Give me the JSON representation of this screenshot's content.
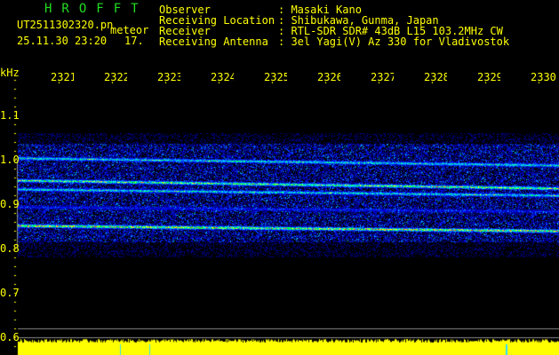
{
  "logo": "HROFFT",
  "file": "UT2511302320.pn",
  "mode": "meteor",
  "datetime": "25.11.30 23:20",
  "level": "17.",
  "info": [
    {
      "label": "Observer",
      "value": "Masaki Kano"
    },
    {
      "label": "Receiving Location",
      "value": "Shibukawa, Gunma, Japan"
    },
    {
      "label": "Receiver",
      "value": "RTL-SDR SDR# 43dB L15 103.2MHz CW"
    },
    {
      "label": "Receiving Antenna",
      "value": "3el Yagi(V) Az 330 for Vladivostok"
    }
  ],
  "yunit": "kHz",
  "time_ticks": [
    "2321",
    "2322",
    "2323",
    "2324",
    "2325",
    "2326",
    "2327",
    "2328",
    "2329",
    "2330"
  ],
  "freq_ticks": [
    "1.1",
    "1.0",
    "0.9",
    "0.8",
    "0.7",
    "0.6"
  ],
  "colors": {
    "text": "#ffff00",
    "logo": "#22dd22"
  }
}
